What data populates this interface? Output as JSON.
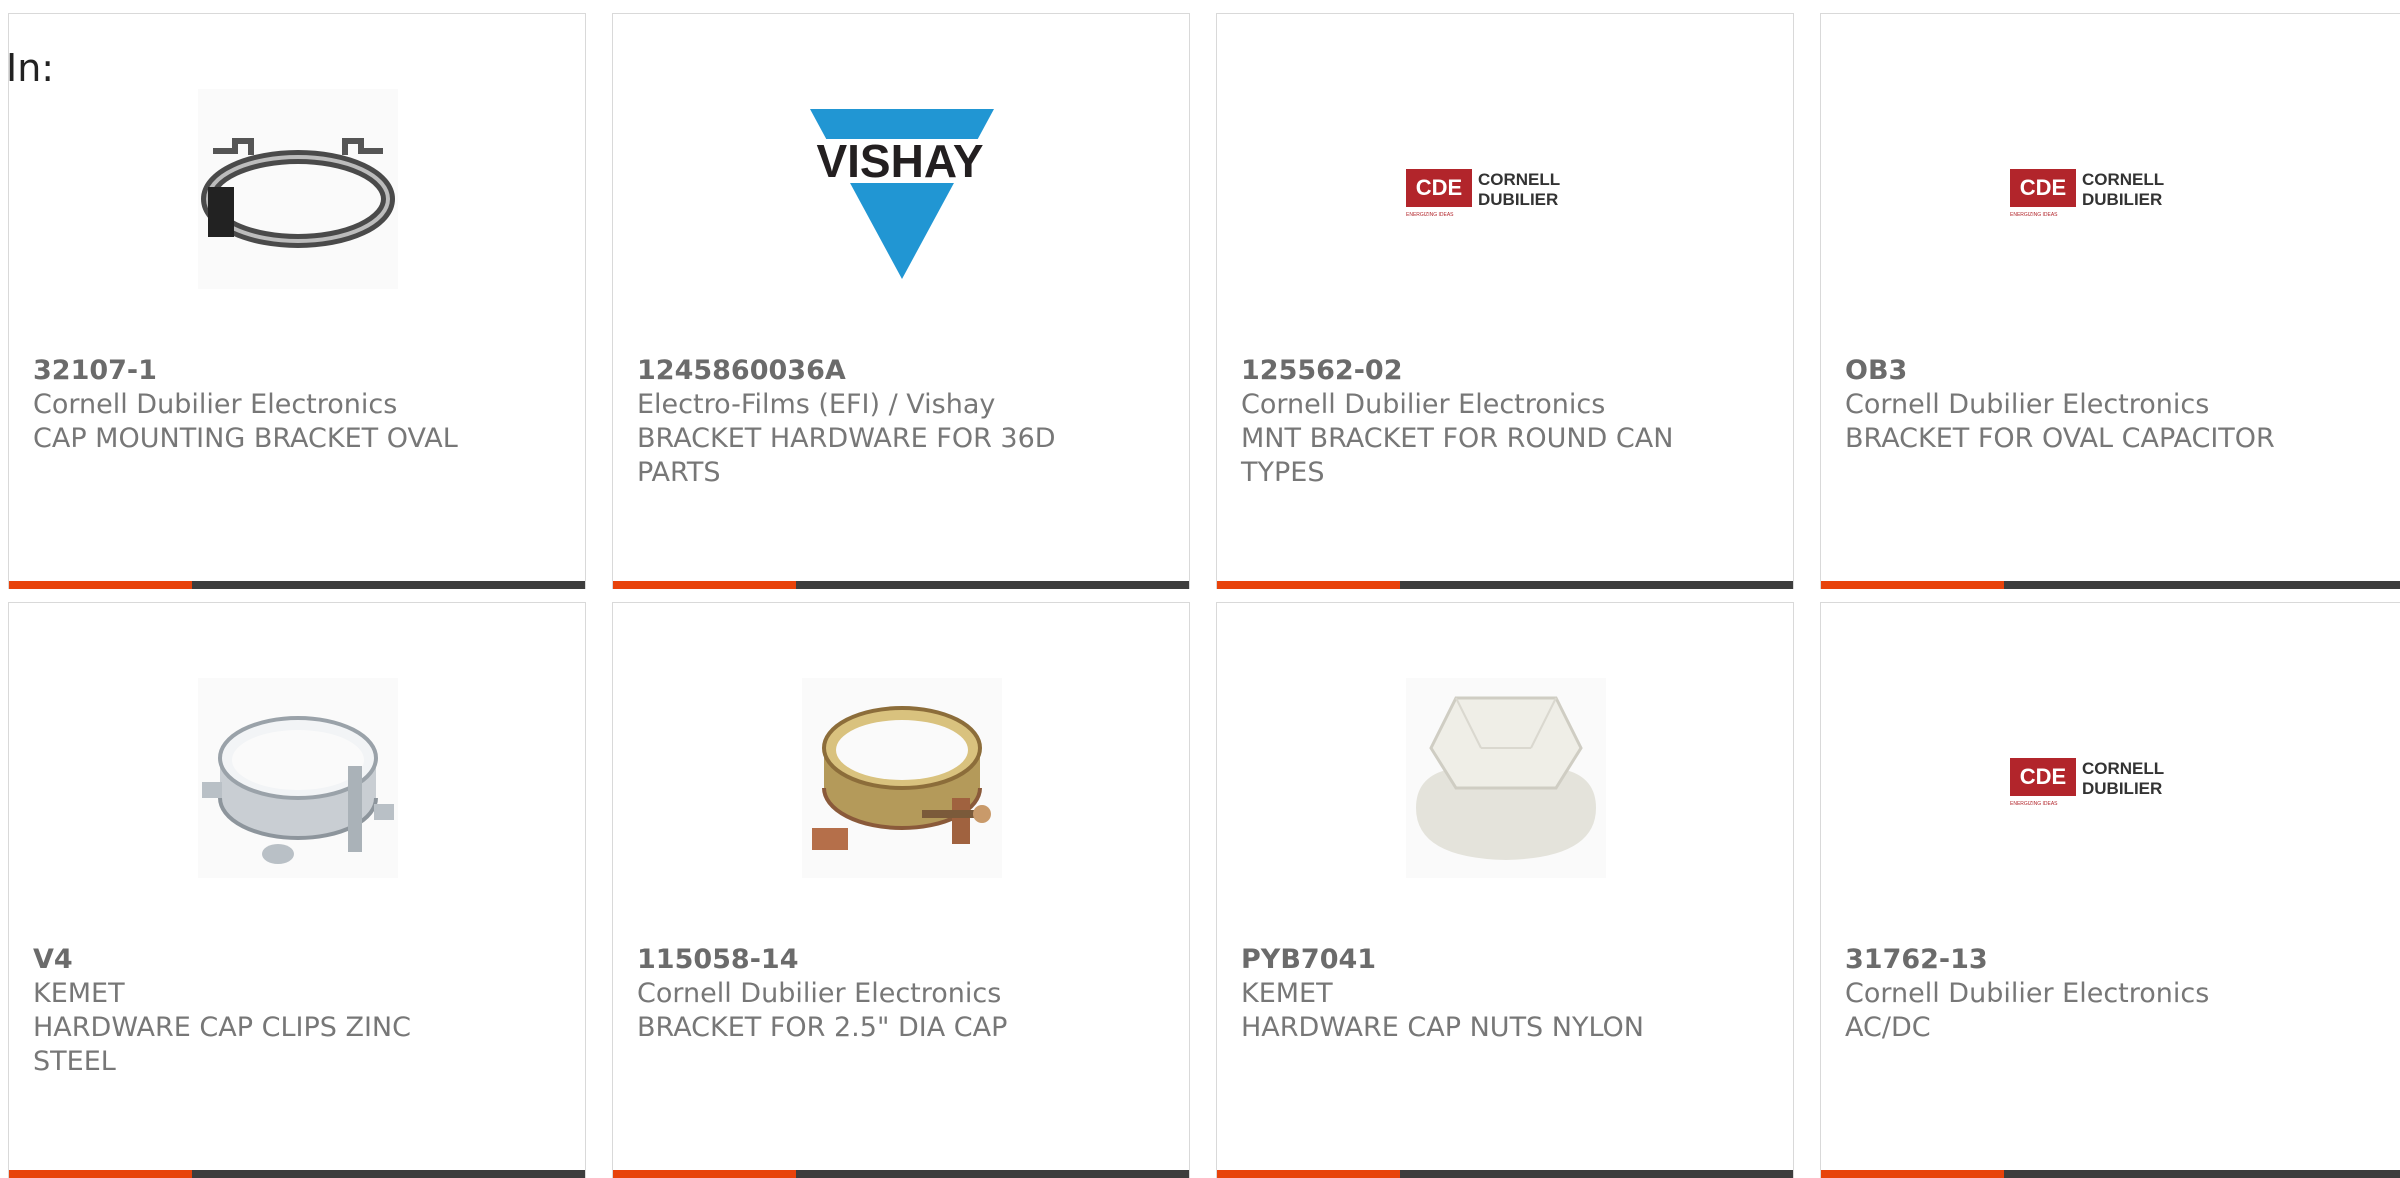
{
  "page": {
    "filter_label": "In:"
  },
  "colors": {
    "accent": "#e8430b",
    "bar": "#3d3d3d",
    "text": "#777777",
    "border": "#d9d9d9"
  },
  "products": [
    {
      "part_number": "32107-1",
      "manufacturer": "Cornell Dubilier Electronics",
      "description": "CAP MOUNTING BRACKET OVAL",
      "image": "oval-bracket"
    },
    {
      "part_number": "1245860036A",
      "manufacturer": "Electro-Films (EFI) / Vishay",
      "description": "BRACKET HARDWARE FOR 36D PARTS",
      "image": "vishay-logo",
      "logo_text": "VISHAY"
    },
    {
      "part_number": "125562-02",
      "manufacturer": "Cornell Dubilier Electronics",
      "description": "MNT BRACKET FOR ROUND CAN TYPES",
      "image": "cde-logo",
      "logo_text": "CDE",
      "logo_line1": "CORNELL",
      "logo_line2": "DUBILIER",
      "logo_tagline": "ENERGIZING IDEAS"
    },
    {
      "part_number": "OB3",
      "manufacturer": "Cornell Dubilier Electronics",
      "description": "BRACKET FOR OVAL CAPACITOR",
      "image": "cde-logo",
      "logo_text": "CDE",
      "logo_line1": "CORNELL",
      "logo_line2": "DUBILIER",
      "logo_tagline": "ENERGIZING IDEAS"
    },
    {
      "part_number": "V4",
      "manufacturer": "KEMET",
      "description": "HARDWARE CAP CLIPS ZINC STEEL",
      "image": "zinc-clamp"
    },
    {
      "part_number": "115058-14",
      "manufacturer": "Cornell Dubilier Electronics",
      "description": "BRACKET FOR 2.5\" DIA CAP",
      "image": "brass-clamp"
    },
    {
      "part_number": "PYB7041",
      "manufacturer": "KEMET",
      "description": "HARDWARE CAP NUTS NYLON",
      "image": "nylon-nut"
    },
    {
      "part_number": "31762-13",
      "manufacturer": "Cornell Dubilier Electronics",
      "description": "AC/DC",
      "image": "cde-logo",
      "logo_text": "CDE",
      "logo_line1": "CORNELL",
      "logo_line2": "DUBILIER",
      "logo_tagline": "ENERGIZING IDEAS"
    }
  ]
}
